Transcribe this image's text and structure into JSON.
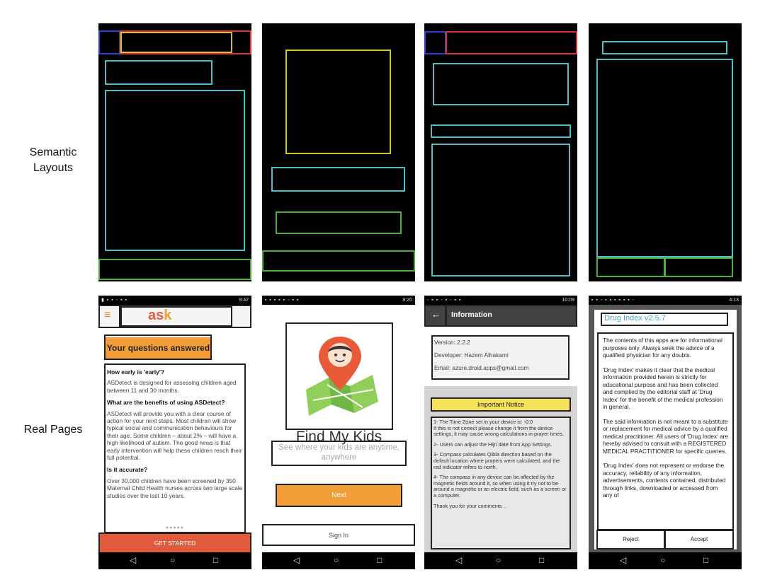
{
  "row_labels": {
    "semantic": "Semantic\nLayouts",
    "real": "Real Pages"
  },
  "pages": [
    {
      "status_time": "9:42",
      "logo_text_a": "as",
      "logo_text_b": "k",
      "hero": "Your questions answered",
      "sections": [
        {
          "heading": "How early is 'early'?",
          "body": "ASDetect is designed for assessing children aged between 11 and 30 months."
        },
        {
          "heading": "What are the benefits of using ASDetect?",
          "body": "ASDetect will provide you with a clear course of action for your next steps. Most children will show typical social and communication behaviours for their age. Some children – about 2% – will have a high likelihood of autism. The good news is that early intervention will help these children reach their full potential."
        },
        {
          "heading": "Is it accurate?",
          "body": "Over 30,000 children have been screened by 350 Maternal Child Health nurses across two large scale studies over the last 10 years."
        }
      ],
      "dots": "●●●●●",
      "button": "GET STARTED"
    },
    {
      "status_time": "8:20",
      "title": "Find My Kids",
      "tagline": "See where your kids are anytime, anywhere",
      "next": "Next",
      "signin": "Sign In"
    },
    {
      "status_time": "10:09",
      "title": "Information",
      "version": "Version:  2.2.2",
      "developer": "Developer:  Hazem Alhakami",
      "email": "Email:  azure.droid.apps@gmail.com",
      "notice_title": "Important Notice",
      "notices": [
        "1- The Time Zone set in your device is: -0.0\nIf this is not correct please change it from the device settings, it may cause wrong calculations in prayer times.",
        "2- Users can adjust the Hijri date from App Settings.",
        "3- Compass calculates Qibla direction based on the default location where prayers were calculated, and the red indicator refers to north.",
        "4- The compass in any device can be affected by the magnetic fields around it, so when using it try not to be around a magnetic or an electric field, such as a screen or a computer.",
        "Thank you for your comments .."
      ]
    },
    {
      "status_time": "4:13",
      "title": "Drug Index v2.5.7",
      "paragraphs": [
        "The contents of this apps are for informational purposes only. Always seek the advice of a qualified physician for any doubts.",
        "'Drug Index' makes it clear that the medical information provided herein is strictly for educational purpose and has been collected and complied by the editorial staff at 'Drug Index' for the benefit of the medical profession in general.",
        "The said information is not meant to a substitute or replacement for medical advice by a qualified medical practitioner. All users of 'Drug Index' are hereby advised to consult with a REGISTERED MEDICAL PRACTITIONER for specific queries.",
        "'Drug Index' does not represent or endorse the accuracy, reliability of any information, advertisements, contents contained, distributed through links, downloaded or accessed from any of"
      ],
      "reject": "Reject",
      "accept": "Accept"
    }
  ],
  "icons": {
    "menu": "≡",
    "back_arrow": "←",
    "nav_back": "◁",
    "nav_home": "○",
    "nav_recent": "□"
  },
  "colors": {
    "red": "#e03030",
    "blue": "#2a3fe0",
    "yellow": "#d6c52a",
    "cyan": "#4fbfc7",
    "green": "#4caf3a",
    "ask_orange": "#f29d38",
    "ask_red": "#e05a3b"
  }
}
